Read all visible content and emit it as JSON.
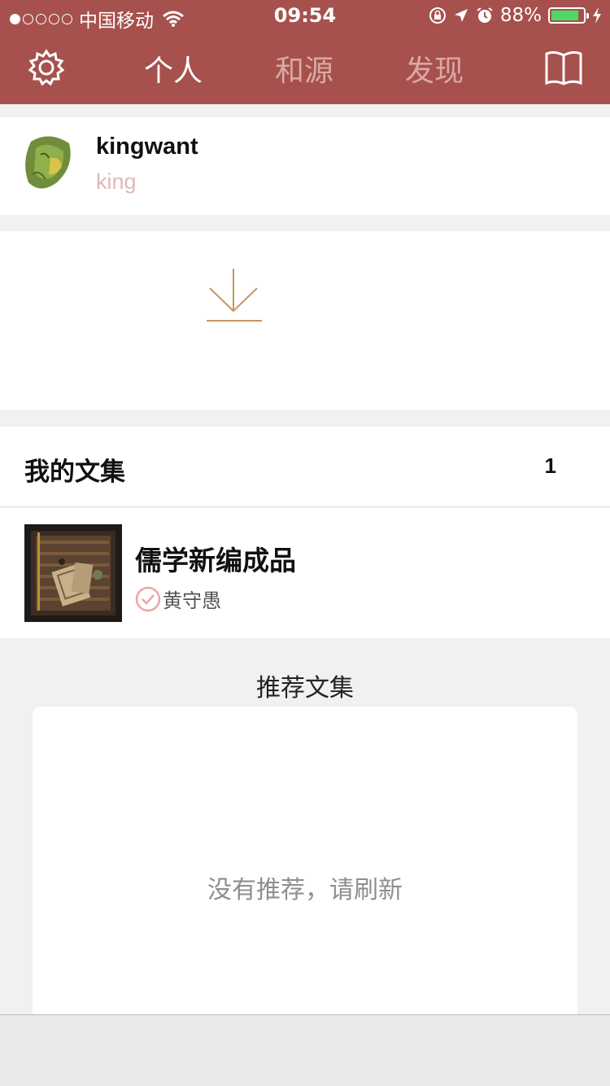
{
  "status_bar": {
    "carrier": "中国移动",
    "time": "09:54",
    "battery_percent": "88%",
    "battery_level": 0.88,
    "icons": [
      "wifi-icon",
      "rotation-lock-icon",
      "location-arrow-icon",
      "alarm-icon",
      "charging-bolt-icon"
    ]
  },
  "nav": {
    "settings_icon": "gear-icon",
    "tabs": [
      {
        "label": "个人",
        "active": true
      },
      {
        "label": "和源",
        "active": false
      },
      {
        "label": "发现",
        "active": false
      }
    ],
    "book_icon": "book-icon"
  },
  "profile": {
    "username": "kingwant",
    "subname": "king"
  },
  "download": {
    "icon": "download-icon"
  },
  "collections": {
    "title": "我的文集",
    "count": "1",
    "items": [
      {
        "title": "儒学新编成品",
        "author": "黄守愚"
      }
    ]
  },
  "recommend": {
    "title": "推荐文集",
    "empty_text": "没有推荐，请刷新"
  },
  "colors": {
    "brand": "#a6514d",
    "inactive_tab": "#dba9a6",
    "accent_pink": "#e9a6a6",
    "download_icon": "#c9955e"
  }
}
